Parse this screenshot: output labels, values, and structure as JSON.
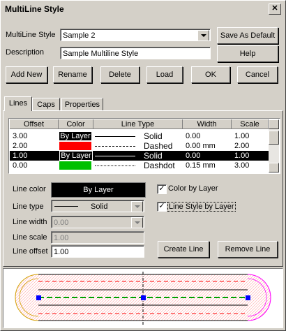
{
  "window": {
    "title": "MultiLine Style",
    "close_glyph": "✕"
  },
  "top": {
    "style_label": "MultiLine Style",
    "style_value": "Sample 2",
    "save_default": "Save As Default",
    "desc_label": "Description",
    "desc_value": "Sample Multiline Style",
    "help": "Help"
  },
  "buttons": {
    "add_new": "Add New",
    "rename": "Rename",
    "delete": "Delete",
    "load": "Load",
    "ok": "OK",
    "cancel": "Cancel"
  },
  "tabs": [
    "Lines",
    "Caps",
    "Properties"
  ],
  "grid": {
    "headers": [
      "Offset",
      "Color",
      "Line Type",
      "Width",
      "Scale"
    ],
    "rows": [
      {
        "offset": "3.00",
        "color": "By Layer",
        "color_hex": "#000000",
        "linetype": "Solid",
        "width": "0.00",
        "scale": "1.00"
      },
      {
        "offset": "2.00",
        "color": "",
        "color_hex": "#ff0000",
        "linetype": "Dashed",
        "width": "0.00 mm",
        "scale": "2.00"
      },
      {
        "offset": "1.00",
        "color": "By Layer",
        "color_hex": "#000000",
        "linetype": "Solid",
        "width": "0.00",
        "scale": "1.00"
      },
      {
        "offset": "0.00",
        "color": "",
        "color_hex": "#00c000",
        "linetype": "Dashdot",
        "width": "0.15 mm",
        "scale": "3.00"
      }
    ]
  },
  "props": {
    "line_color_label": "Line color",
    "line_color_value": "By Layer",
    "line_type_label": "Line type",
    "line_type_value": "Solid",
    "line_width_label": "Line width",
    "line_width_value": "0.00",
    "line_scale_label": "Line scale",
    "line_scale_value": "1.00",
    "line_offset_label": "Line offset",
    "line_offset_value": "1.00",
    "color_by_layer": "Color by Layer",
    "style_by_layer": "Line Style by Layer",
    "create_line": "Create Line",
    "remove_line": "Remove Line"
  },
  "colors": {
    "selected_row": "#000000",
    "preview_red": "#ff0000",
    "preview_green": "#00a000",
    "preview_blue": "#0000ff",
    "cap_left": "#d4a000",
    "cap_right": "#ff00ff"
  }
}
